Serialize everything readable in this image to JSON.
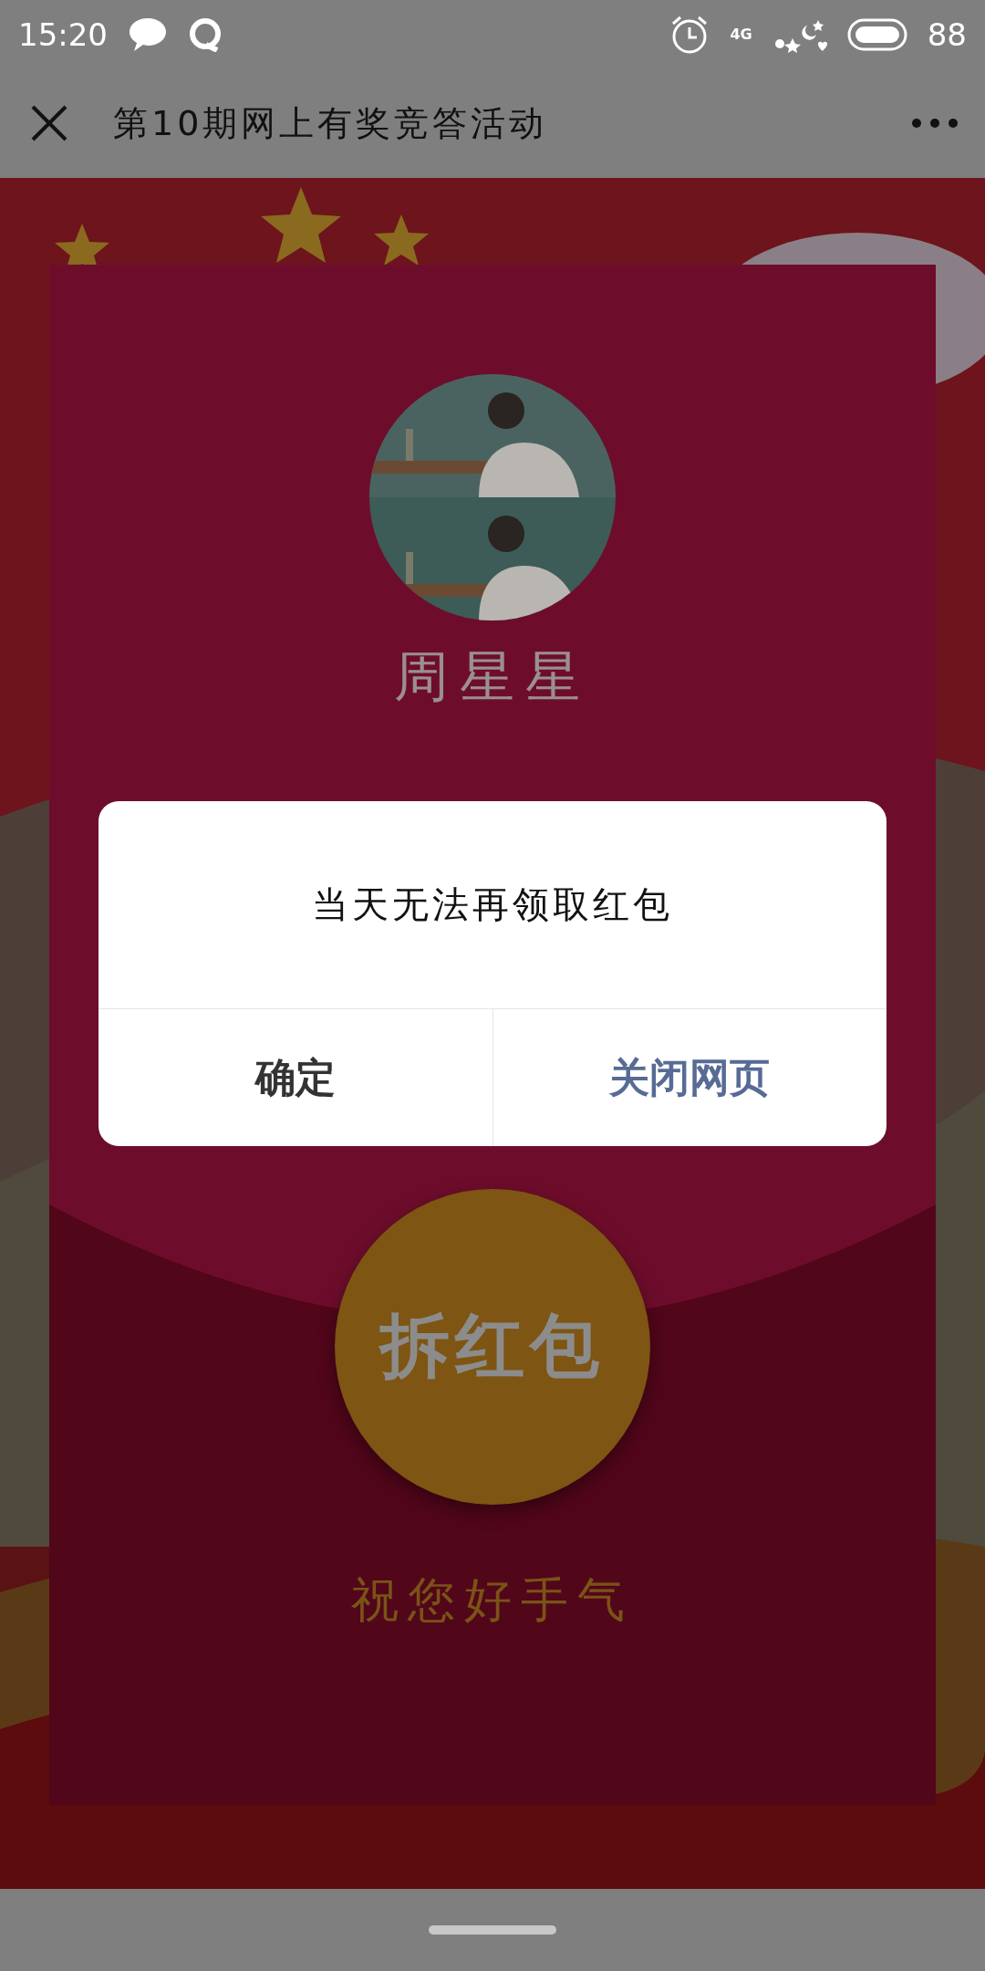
{
  "status_bar": {
    "time": "15:20",
    "network": "4G",
    "battery": "88"
  },
  "nav_bar": {
    "title": "第10期网上有奖竞答活动"
  },
  "red_packet": {
    "sender": "周星星",
    "open_button": "拆红包",
    "greeting": "祝您好手气"
  },
  "dialog": {
    "message": "当天无法再领取红包",
    "buttons": [
      {
        "label": "确定",
        "kind": "default"
      },
      {
        "label": "关闭网页",
        "kind": "primary"
      }
    ]
  }
}
